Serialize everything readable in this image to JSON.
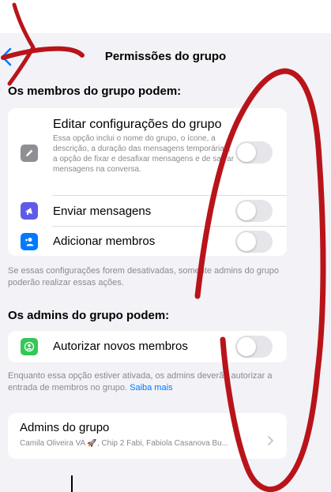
{
  "header": {
    "title": "Permissões do grupo"
  },
  "members_section": {
    "title": "Os membros do grupo podem:",
    "rows": [
      {
        "label": "Editar configurações do grupo",
        "description": "Essa opção inclui o nome do grupo, o ícone, a descrição, a duração das mensagens temporárias, a opção de fixar e desafixar mensagens e de salvar mensagens na conversa.",
        "icon": "pencil-icon",
        "icon_color": "#8e8e93",
        "enabled": false
      },
      {
        "label": "Enviar mensagens",
        "icon": "megaphone-icon",
        "icon_color": "#5e5ce6",
        "enabled": false
      },
      {
        "label": "Adicionar membros",
        "icon": "add-person-icon",
        "icon_color": "#007aff",
        "enabled": false
      }
    ],
    "footnote": "Se essas configurações forem desativadas, somente admins do grupo poderão realizar essas ações."
  },
  "admins_section": {
    "title": "Os admins do grupo podem:",
    "rows": [
      {
        "label": "Autorizar novos membros",
        "icon": "approve-members-icon",
        "icon_color": "#34c759",
        "enabled": false
      }
    ],
    "footnote": "Enquanto essa opção estiver ativada, os admins deverão autorizar a entrada de membros no grupo.",
    "footnote_link": "Saiba mais"
  },
  "admins_list": {
    "label": "Admins do grupo",
    "subtitle": "Camila Oliveira VA 🚀, Chip 2 Fabi, Fabiola Casanova Bu..."
  },
  "colors": {
    "annotation": "#b8141a",
    "link": "#007aff",
    "toggle_off": "#e5e5ea"
  }
}
